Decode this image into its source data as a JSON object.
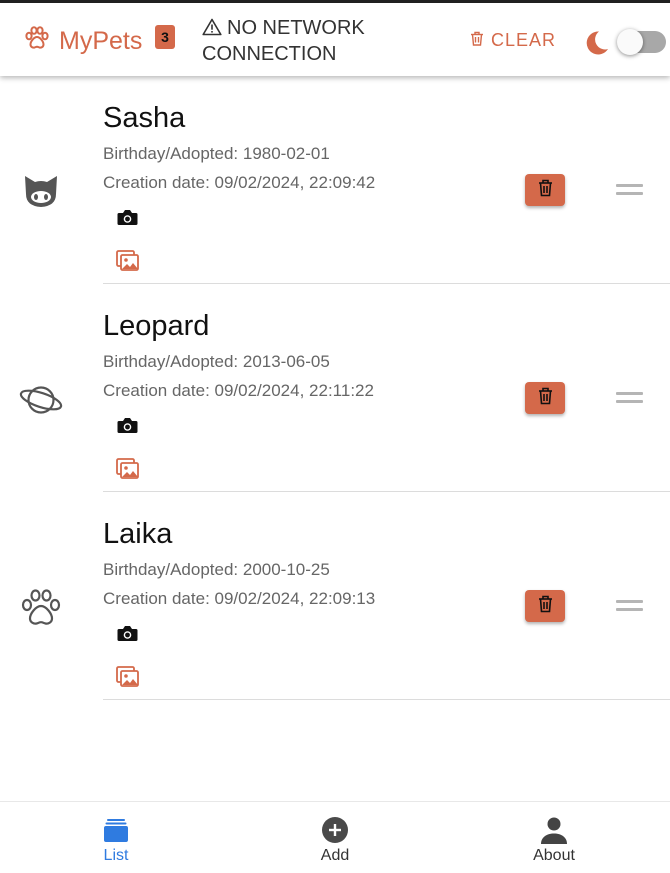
{
  "header": {
    "app_title": "MyPets",
    "pet_count_badge": "3",
    "network_status": "NO NETWORK CONNECTION",
    "clear_label": "CLEAR",
    "dark_mode_enabled": false
  },
  "pets": [
    {
      "name": "Sasha",
      "birthday_text": "Birthday/Adopted: 1980-02-01",
      "creation_text": "Creation date: 09/02/2024, 22:09:42",
      "avatar_icon": "github-cat-icon"
    },
    {
      "name": "Leopard",
      "birthday_text": "Birthday/Adopted: 2013-06-05",
      "creation_text": "Creation date: 09/02/2024, 22:11:22",
      "avatar_icon": "planet-icon"
    },
    {
      "name": "Laika",
      "birthday_text": "Birthday/Adopted: 2000-10-25",
      "creation_text": "Creation date: 09/02/2024, 22:09:13",
      "avatar_icon": "paw-icon"
    }
  ],
  "bottom_nav": {
    "list_label": "List",
    "add_label": "Add",
    "about_label": "About",
    "active": "List"
  },
  "colors": {
    "accent": "#d4694a",
    "active_nav": "#2f7be0",
    "icon_gray": "#555555"
  }
}
